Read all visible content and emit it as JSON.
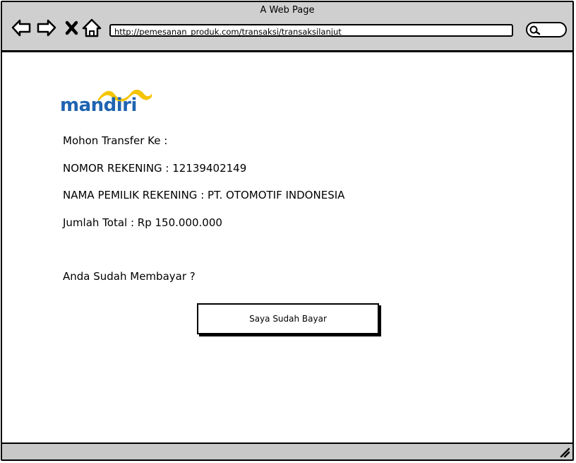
{
  "window": {
    "title": "A Web Page",
    "url": "http://pemesanan_produk.com/transaksi/transaksilanjut"
  },
  "toolbar": {
    "icons": [
      "back-arrow-icon",
      "forward-arrow-icon",
      "close-x-icon",
      "home-icon",
      "search-icon"
    ]
  },
  "logo": {
    "text": "mandiri",
    "brand_color": "#1f64b1",
    "wave_color": "#f5c400"
  },
  "payment": {
    "instruction": "Mohon Transfer Ke :",
    "account_number": "NOMOR REKENING : 12139402149",
    "account_holder": "NAMA PEMILIK REKENING : PT. OTOMOTIF INDONESIA",
    "total": "Jumlah Total : Rp 150.000.000",
    "question": "Anda Sudah Membayar ?",
    "confirm_button": "Saya Sudah Bayar"
  }
}
